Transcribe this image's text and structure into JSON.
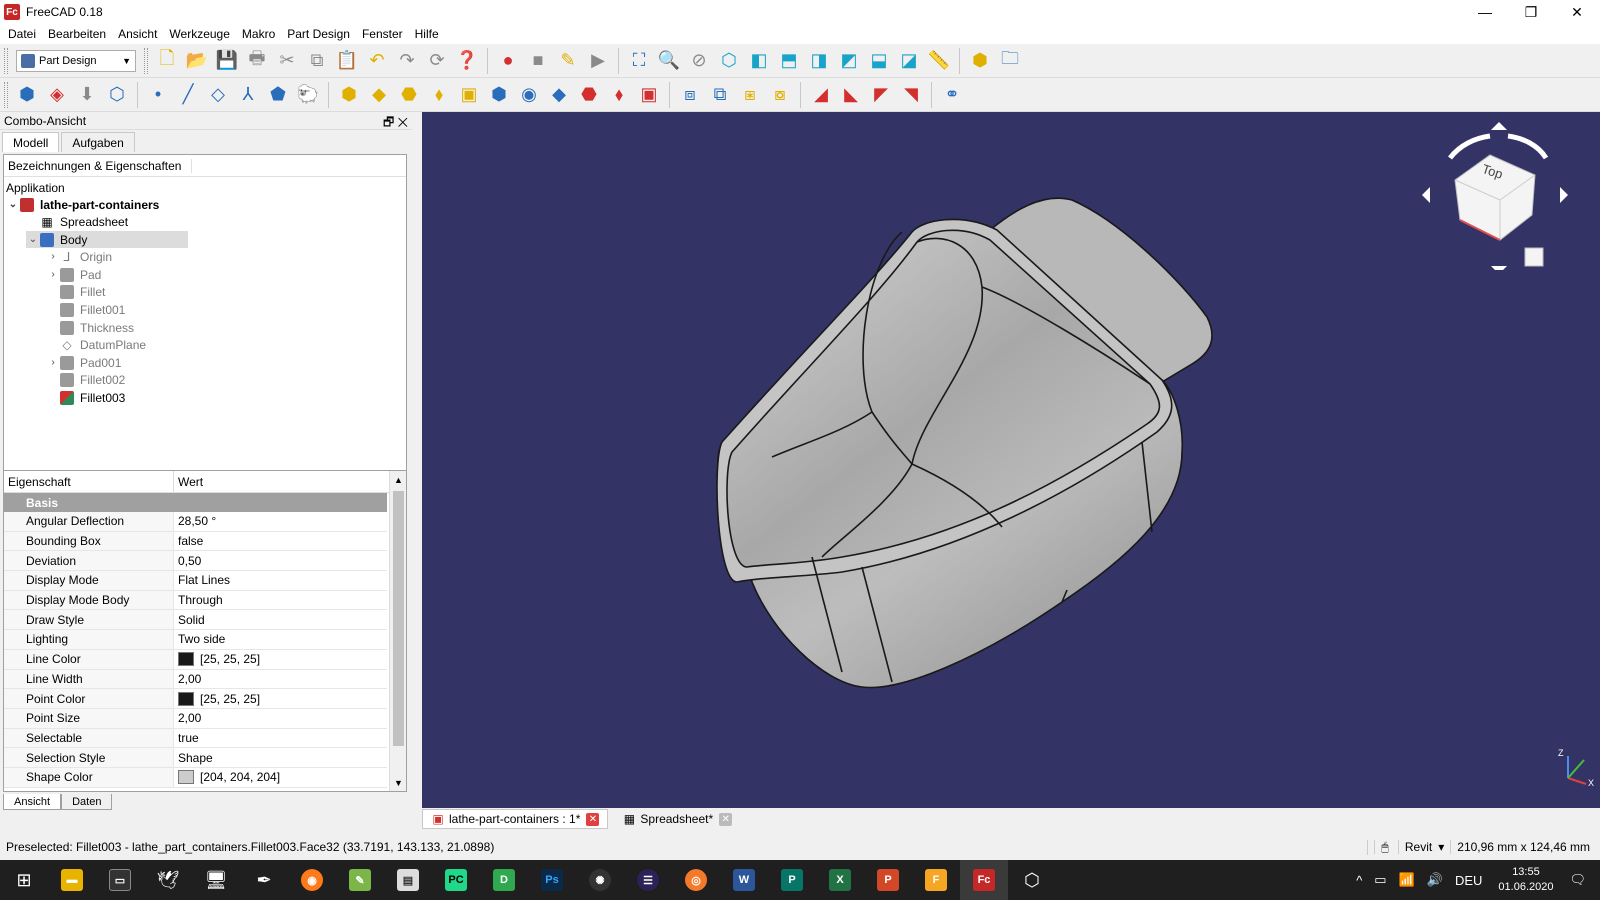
{
  "window": {
    "title": "FreeCAD 0.18",
    "app_icon_text": "Fc",
    "minimize": "—",
    "maximize": "❐",
    "close": "✕"
  },
  "menu": [
    "Datei",
    "Bearbeiten",
    "Ansicht",
    "Werkzeuge",
    "Makro",
    "Part Design",
    "Fenster",
    "Hilfe"
  ],
  "toolbar": {
    "workbench": "Part Design"
  },
  "combo": {
    "title": "Combo-Ansicht",
    "header_buttons": "🗗 ✕",
    "tabs": [
      "Modell",
      "Aufgaben"
    ],
    "tree_header": "Bezeichnungen & Eigenschaften",
    "tree": [
      {
        "label": "Applikation"
      },
      {
        "label": "lathe-part-containers"
      },
      {
        "label": "Spreadsheet"
      },
      {
        "label": "Body"
      },
      {
        "label": "Origin"
      },
      {
        "label": "Pad"
      },
      {
        "label": "Fillet"
      },
      {
        "label": "Fillet001"
      },
      {
        "label": "Thickness"
      },
      {
        "label": "DatumPlane"
      },
      {
        "label": "Pad001"
      },
      {
        "label": "Fillet002"
      },
      {
        "label": "Fillet003"
      }
    ],
    "properties": {
      "col_name": "Eigenschaft",
      "col_value": "Wert",
      "group": "Basis",
      "rows": [
        {
          "name": "Angular Deflection",
          "value": "28,50 °"
        },
        {
          "name": "Bounding Box",
          "value": "false"
        },
        {
          "name": "Deviation",
          "value": "0,50"
        },
        {
          "name": "Display Mode",
          "value": "Flat Lines"
        },
        {
          "name": "Display Mode Body",
          "value": "Through"
        },
        {
          "name": "Draw Style",
          "value": "Solid"
        },
        {
          "name": "Lighting",
          "value": "Two side"
        },
        {
          "name": "Line Color",
          "value": "[25, 25, 25]",
          "swatch": "#191919"
        },
        {
          "name": "Line Width",
          "value": "2,00"
        },
        {
          "name": "Point Color",
          "value": "[25, 25, 25]",
          "swatch": "#191919"
        },
        {
          "name": "Point Size",
          "value": "2,00"
        },
        {
          "name": "Selectable",
          "value": "true"
        },
        {
          "name": "Selection Style",
          "value": "Shape"
        },
        {
          "name": "Shape Color",
          "value": "[204, 204, 204]",
          "swatch": "#cccccc"
        }
      ]
    },
    "bottom_tabs": [
      "Ansicht",
      "Daten"
    ]
  },
  "navcube": {
    "face": "Top"
  },
  "axis": {
    "x": "X",
    "z": "Z"
  },
  "doc_tabs": [
    {
      "label": "lathe-part-containers : 1*"
    },
    {
      "label": "Spreadsheet*"
    }
  ],
  "status": {
    "text": "Preselected: Fillet003 - lathe_part_containers.Fillet003.Face32 (33.7191, 143.133, 21.0898)",
    "nav_style": "Revit",
    "dimensions": "210,96 mm x 124,46 mm"
  },
  "taskbar": {
    "lang": "DEU",
    "time": "13:55",
    "date": "01.06.2020"
  },
  "colors": {
    "viewport_bg": "#333366",
    "model_gray": "#b4b4b4"
  }
}
